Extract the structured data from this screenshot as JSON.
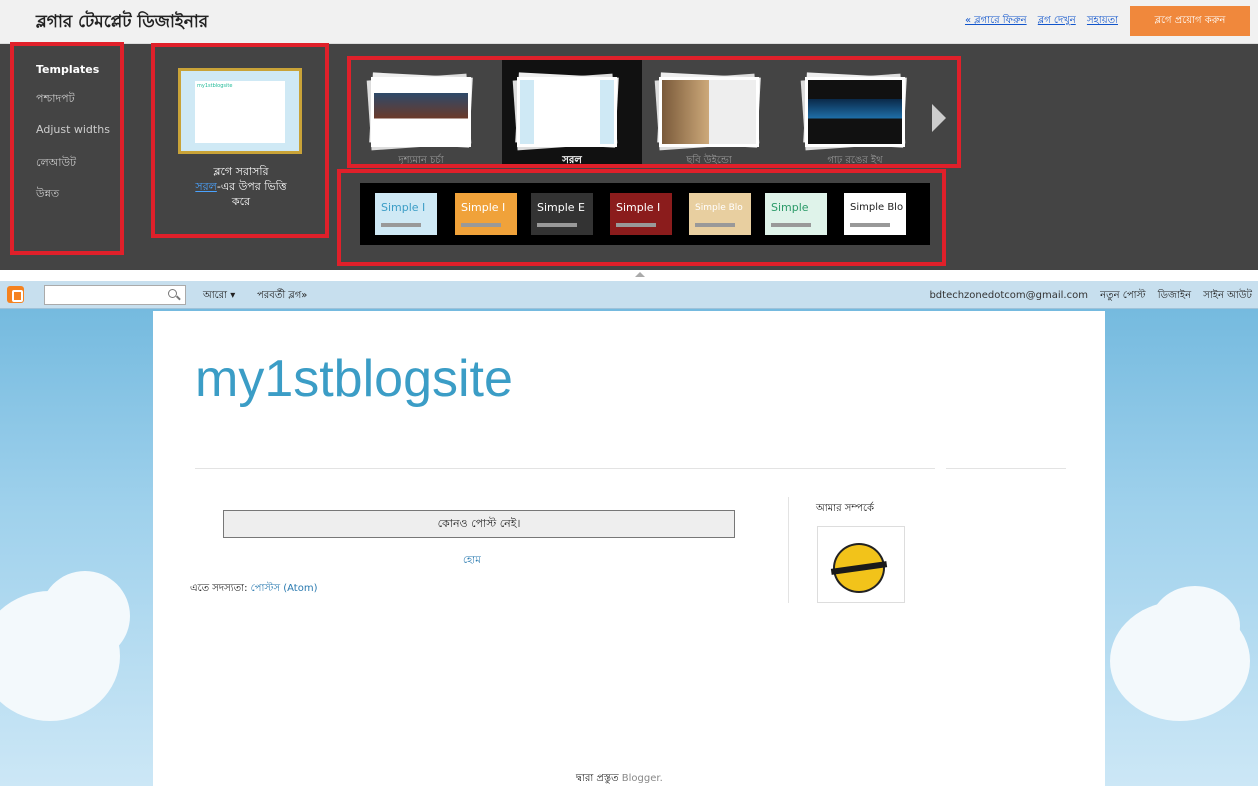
{
  "app": {
    "title": "ব্লগার টেমপ্লেট ডিজাইনার",
    "links": [
      "« ব্লগারে ফিরুন",
      "ব্লগ দেখুন",
      "সহায়তা"
    ],
    "apply_button": "ব্লগে প্রয়োগ করুন"
  },
  "sidebar": {
    "items": [
      "Templates",
      "পশ্চাদপট",
      "Adjust widths",
      "লেআউট",
      "উন্নত"
    ],
    "active": "Templates"
  },
  "current_template": {
    "thumb_title": "my1stblogsite",
    "line1": "ব্লগে সরাসরি",
    "link": "সরল",
    "line2": "-এর উপর ভিত্তি",
    "line3": "করে"
  },
  "template_strip": {
    "items": [
      {
        "label": "দৃশ্যমান চর্চা"
      },
      {
        "label": "সরল"
      },
      {
        "label": "ছবি উইন্ডো"
      },
      {
        "label": "গাঢ় রঙের ইথ"
      }
    ],
    "selected": "সরল"
  },
  "variants": [
    {
      "label": "Simple I",
      "bg": "#cfe9f5",
      "fg": "#3b9dc6"
    },
    {
      "label": "Simple I",
      "bg": "#f0a23a",
      "fg": "#ffffff"
    },
    {
      "label": "Simple E",
      "bg": "#333333",
      "fg": "#ffffff"
    },
    {
      "label": "Simple I",
      "bg": "#8b1c1c",
      "fg": "#ffffff"
    },
    {
      "label": "Simple Blo",
      "bg": "#e8cfa0",
      "fg": "#ffffff"
    },
    {
      "label": "Simple",
      "bg": "#dff3ea",
      "fg": "#2a9a68"
    },
    {
      "label": "Simple Blo",
      "bg": "#ffffff",
      "fg": "#222222"
    }
  ],
  "navbar": {
    "more": "আরো ▾",
    "next_blog": "পরবর্তী ব্লগ»",
    "email": "bdtechzonedotcom@gmail.com",
    "new_post": "নতুন পোস্ট",
    "design": "ডিজাইন",
    "sign_out": "সাইন আউট"
  },
  "blog": {
    "title": "my1stblogsite",
    "no_posts": "কোনও পোস্ট নেই।",
    "home": "হোম",
    "subscribe_label": "এতে সদস্যতা: ",
    "subscribe_link": "পোস্টস (Atom)",
    "about_title": "আমার সম্পর্কে",
    "powered_by": "দ্বারা প্রস্তুত ",
    "powered_by_brand": "Blogger."
  },
  "colors": {
    "accent": "#f0883c",
    "highlight_box": "#e0202a",
    "blog_title": "#3b9dc6"
  }
}
